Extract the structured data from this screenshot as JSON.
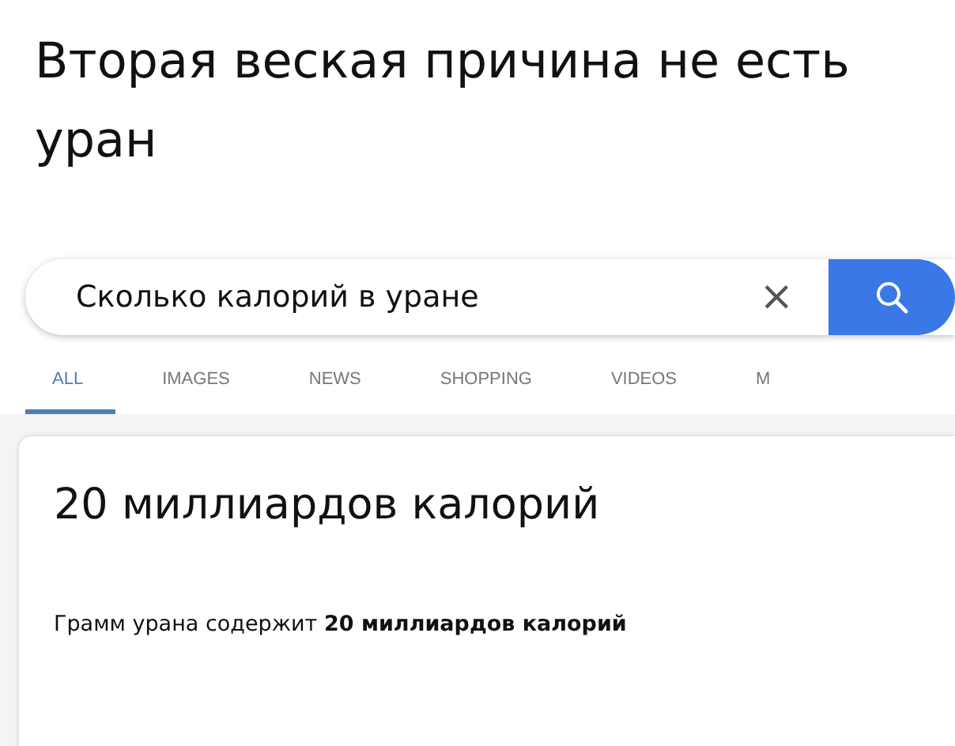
{
  "caption": "Вторая веская причина не есть уран",
  "search": {
    "value": "Сколько калорий в уране",
    "clear": "×"
  },
  "tabs": [
    {
      "label": "ALL",
      "selected": true
    },
    {
      "label": "IMAGES",
      "selected": false
    },
    {
      "label": "NEWS",
      "selected": false
    },
    {
      "label": "SHOPPING",
      "selected": false
    },
    {
      "label": "VIDEOS",
      "selected": false
    },
    {
      "label": "M",
      "selected": false
    }
  ],
  "answer": {
    "title": "20 миллиардов калорий",
    "snippet": "Грамм урана содержит **20 миллиардов калорий**"
  }
}
